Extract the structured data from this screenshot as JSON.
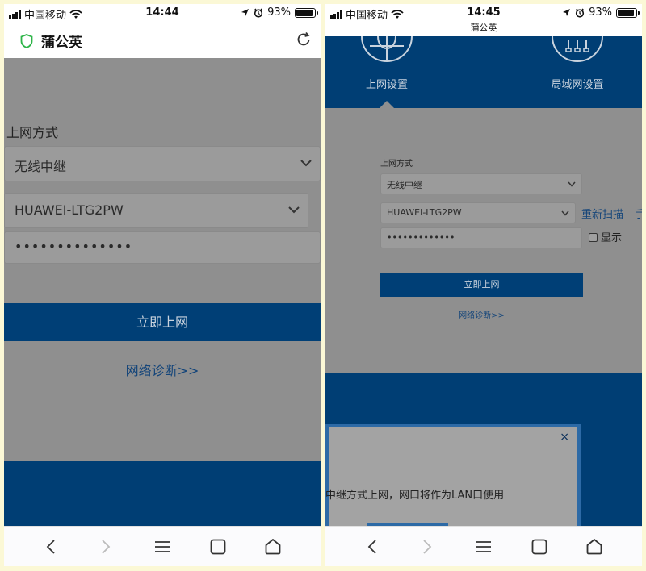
{
  "left": {
    "status": {
      "carrier": "中国移动",
      "time": "14:44",
      "battery": "93%",
      "battery_level": 0.93
    },
    "header": {
      "site_name": "蒲公英"
    },
    "form": {
      "access_label": "上网方式",
      "access_value": "无线中继",
      "ssid_value": "HUAWEI-LTG2PW",
      "password_mask": "••••••••••••••",
      "connect_label": "立即上网",
      "diagnose_label": "网络诊断>>"
    }
  },
  "right": {
    "status": {
      "carrier": "中国移动",
      "time": "14:45",
      "battery": "93%",
      "battery_level": 0.93,
      "site_name": "蒲公英"
    },
    "tabs": {
      "internet_label": "上网设置",
      "lan_label": "局域网设置"
    },
    "form": {
      "access_label": "上网方式",
      "access_value": "无线中继",
      "ssid_value": "HUAWEI-LTG2PW",
      "rescan_label": "重新扫描",
      "manual_label": "手",
      "password_mask": "•••••••••••••",
      "show_label": "显示",
      "connect_label": "立即上网",
      "diagnose_label": "网络诊断>>"
    },
    "dialog": {
      "close_symbol": "×",
      "message": "中继方式上网，网口将作为LAN口使用"
    }
  },
  "colors": {
    "brand_blue": "#003f76",
    "overlay_gray": "#8f8f8f",
    "link_blue": "#14457a",
    "shield_green": "#2fb54a"
  },
  "icons": {
    "back": "chevron-left-icon",
    "forward": "chevron-right-icon",
    "menu": "menu-icon",
    "tabs": "tabs-icon",
    "home": "home-icon",
    "refresh": "refresh-icon",
    "shield": "shield-icon"
  }
}
